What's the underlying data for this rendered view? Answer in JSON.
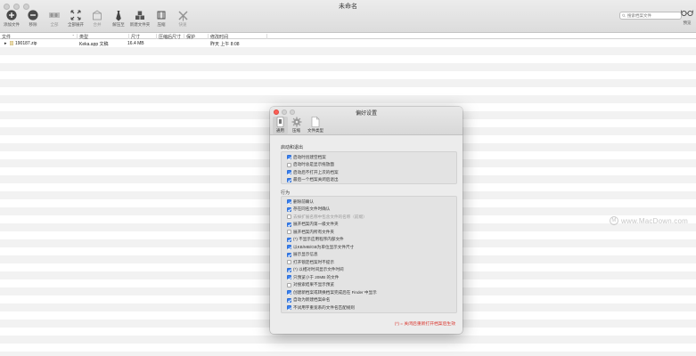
{
  "window": {
    "title": "未命名"
  },
  "toolbar": {
    "items": [
      {
        "label": "添加文件",
        "icon": "add-circle-icon",
        "enabled": true
      },
      {
        "label": "移除",
        "icon": "remove-circle-icon",
        "enabled": true
      },
      {
        "label": "全部",
        "icon": "lines-icon",
        "enabled": false
      },
      {
        "label": "全部展开",
        "icon": "expand-arrows-icon",
        "enabled": true
      },
      {
        "label": "合并",
        "icon": "merge-icon",
        "enabled": false
      },
      {
        "label": "解压至",
        "icon": "tie-icon",
        "enabled": true
      },
      {
        "label": "新建文件夹",
        "icon": "boxes-icon",
        "enabled": true
      },
      {
        "label": "压缩",
        "icon": "compress-icon",
        "enabled": true
      },
      {
        "label": "快速",
        "icon": "windmill-icon",
        "enabled": false
      }
    ],
    "search_placeholder": "搜索档案文件",
    "preview_label": "预览"
  },
  "table": {
    "columns": [
      "文件",
      "类型",
      "尺寸",
      "压缩后尺寸",
      "保护",
      "修改时间"
    ],
    "rows": [
      {
        "name": "190187.zip",
        "type": "Keka.app 文稿",
        "size": "16.4 MB",
        "compressed": "",
        "protected": "",
        "modified": "昨天 上午 8:08"
      }
    ]
  },
  "prefs": {
    "title": "偏好设置",
    "tabs": [
      {
        "label": "通用",
        "icon": "switch-icon",
        "active": true
      },
      {
        "label": "压缩",
        "icon": "gear-icon",
        "active": false
      },
      {
        "label": "文件类型",
        "icon": "document-icon",
        "active": false
      }
    ],
    "section_startup": "启动和退出",
    "startup_options": [
      {
        "label": "启动时创建空档案",
        "checked": true
      },
      {
        "label": "启动时总是显示拖放面",
        "checked": false
      },
      {
        "label": "启动后不打开上次的档案",
        "checked": true
      },
      {
        "label": "最后一个档案关闭后退出",
        "checked": true
      }
    ],
    "section_behavior": "行为",
    "behavior_options": [
      {
        "label": "删除前确认",
        "checked": true
      },
      {
        "label": "存在同名文件时确认",
        "checked": true
      },
      {
        "label": "去掉扩展名称中包含文件的名称（前缀）",
        "checked": false,
        "dim": true
      },
      {
        "label": "展开档案内第一级文件夹",
        "checked": true
      },
      {
        "label": "展开档案内所有文件夹",
        "checked": false
      },
      {
        "label": "(*) 不显示应用程序内部文件",
        "checked": true
      },
      {
        "label": "以KB/MB/GB为单位显示文件尺寸",
        "checked": true
      },
      {
        "label": "展示显示信息",
        "checked": true
      },
      {
        "label": "打开锁定档案时不提示",
        "checked": false
      },
      {
        "label": "(*) 以相对时间显示文件时间",
        "checked": true
      },
      {
        "label": "只预览小于 20MB 的文件",
        "checked": true
      },
      {
        "label": "对搜索结果不显示预览",
        "checked": false
      },
      {
        "label": "创建新档案或转换档案完成后在 Finder 中显示",
        "checked": true
      },
      {
        "label": "自动为新建档案命名",
        "checked": true
      },
      {
        "label": "不试用字重宽系的文件名匹配规则",
        "checked": true
      }
    ],
    "note": "(*) = 关闭后重新打开档案后生效"
  },
  "watermark": "www.MacDown.com",
  "colors": {
    "checkbox_on": "#3b82f0",
    "note_red": "#d9332b"
  }
}
